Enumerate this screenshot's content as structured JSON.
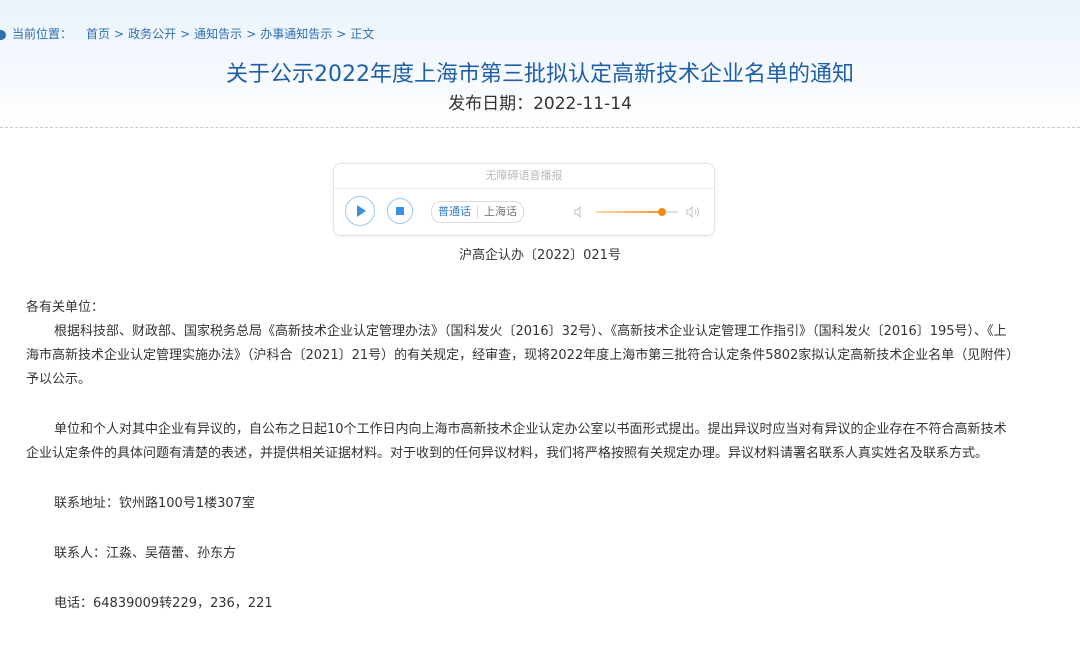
{
  "breadcrumb": {
    "label": "当前位置：",
    "items": [
      "首页",
      "政务公开",
      "通知告示",
      "办事通知告示",
      "正文"
    ],
    "separator": ">"
  },
  "article": {
    "title": "关于公示2022年度上海市第三批拟认定高新技术企业名单的通知",
    "publish_date": "发布日期：2022-11-14",
    "doc_number": "沪高企认办〔2022〕021号"
  },
  "player": {
    "header": "无障碍语音播报",
    "play_icon": "play-icon",
    "stop_icon": "stop-icon",
    "languages": [
      "普通话",
      "上海话"
    ],
    "active_language": "普通话",
    "volume_level": 0.8,
    "accent": "#3a8fe0",
    "volume_color": "#f28c13"
  },
  "body": {
    "salutation": "各有关单位：",
    "paragraph1": "根据科技部、财政部、国家税务总局《高新技术企业认定管理办法》（国科发火〔2016〕32号）、《高新技术企业认定管理工作指引》（国科发火〔2016〕195号）、《上海市高新技术企业认定管理实施办法》（沪科合〔2021〕21号）的有关规定，经审查，现将2022年度上海市第三批符合认定条件5802家拟认定高新技术企业名单（见附件）予以公示。",
    "paragraph2": "单位和个人对其中企业有异议的，自公布之日起10个工作日内向上海市高新技术企业认定办公室以书面形式提出。提出异议时应当对有异议的企业存在不符合高新技术企业认定条件的具体问题有清楚的表述，并提供相关证据材料。对于收到的任何异议材料，我们将严格按照有关规定办理。异议材料请署名联系人真实姓名及联系方式。",
    "address": "联系地址：钦州路100号1楼307室",
    "contacts": "联系人：江淼、吴蓓蕾、孙东方",
    "phone": "电话：64839009转229，236，221"
  },
  "colors": {
    "title": "#1f5fa8",
    "link": "#2f6fb0"
  }
}
